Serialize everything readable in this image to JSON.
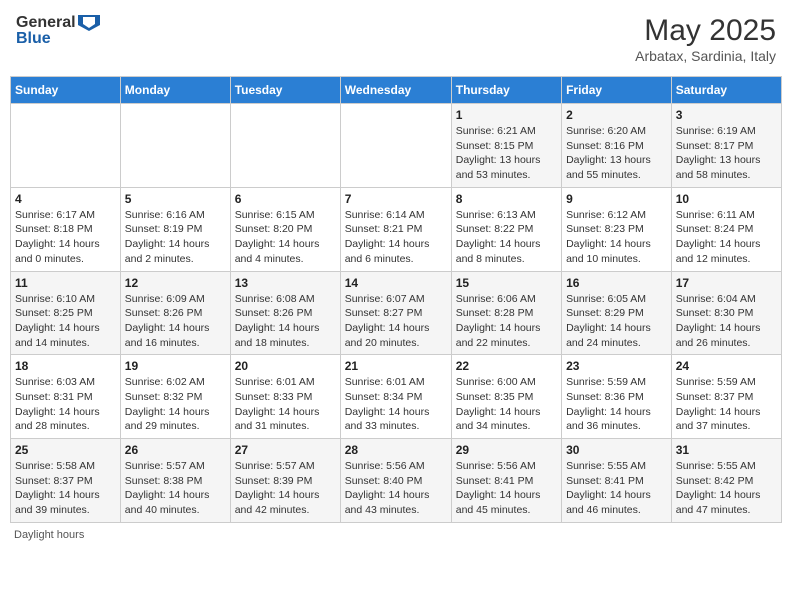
{
  "header": {
    "logo_general": "General",
    "logo_blue": "Blue",
    "title": "May 2025",
    "subtitle": "Arbatax, Sardinia, Italy"
  },
  "days_of_week": [
    "Sunday",
    "Monday",
    "Tuesday",
    "Wednesday",
    "Thursday",
    "Friday",
    "Saturday"
  ],
  "weeks": [
    [
      {
        "day": "",
        "info": ""
      },
      {
        "day": "",
        "info": ""
      },
      {
        "day": "",
        "info": ""
      },
      {
        "day": "",
        "info": ""
      },
      {
        "day": "1",
        "info": "Sunrise: 6:21 AM\nSunset: 8:15 PM\nDaylight: 13 hours and 53 minutes."
      },
      {
        "day": "2",
        "info": "Sunrise: 6:20 AM\nSunset: 8:16 PM\nDaylight: 13 hours and 55 minutes."
      },
      {
        "day": "3",
        "info": "Sunrise: 6:19 AM\nSunset: 8:17 PM\nDaylight: 13 hours and 58 minutes."
      }
    ],
    [
      {
        "day": "4",
        "info": "Sunrise: 6:17 AM\nSunset: 8:18 PM\nDaylight: 14 hours and 0 minutes."
      },
      {
        "day": "5",
        "info": "Sunrise: 6:16 AM\nSunset: 8:19 PM\nDaylight: 14 hours and 2 minutes."
      },
      {
        "day": "6",
        "info": "Sunrise: 6:15 AM\nSunset: 8:20 PM\nDaylight: 14 hours and 4 minutes."
      },
      {
        "day": "7",
        "info": "Sunrise: 6:14 AM\nSunset: 8:21 PM\nDaylight: 14 hours and 6 minutes."
      },
      {
        "day": "8",
        "info": "Sunrise: 6:13 AM\nSunset: 8:22 PM\nDaylight: 14 hours and 8 minutes."
      },
      {
        "day": "9",
        "info": "Sunrise: 6:12 AM\nSunset: 8:23 PM\nDaylight: 14 hours and 10 minutes."
      },
      {
        "day": "10",
        "info": "Sunrise: 6:11 AM\nSunset: 8:24 PM\nDaylight: 14 hours and 12 minutes."
      }
    ],
    [
      {
        "day": "11",
        "info": "Sunrise: 6:10 AM\nSunset: 8:25 PM\nDaylight: 14 hours and 14 minutes."
      },
      {
        "day": "12",
        "info": "Sunrise: 6:09 AM\nSunset: 8:26 PM\nDaylight: 14 hours and 16 minutes."
      },
      {
        "day": "13",
        "info": "Sunrise: 6:08 AM\nSunset: 8:26 PM\nDaylight: 14 hours and 18 minutes."
      },
      {
        "day": "14",
        "info": "Sunrise: 6:07 AM\nSunset: 8:27 PM\nDaylight: 14 hours and 20 minutes."
      },
      {
        "day": "15",
        "info": "Sunrise: 6:06 AM\nSunset: 8:28 PM\nDaylight: 14 hours and 22 minutes."
      },
      {
        "day": "16",
        "info": "Sunrise: 6:05 AM\nSunset: 8:29 PM\nDaylight: 14 hours and 24 minutes."
      },
      {
        "day": "17",
        "info": "Sunrise: 6:04 AM\nSunset: 8:30 PM\nDaylight: 14 hours and 26 minutes."
      }
    ],
    [
      {
        "day": "18",
        "info": "Sunrise: 6:03 AM\nSunset: 8:31 PM\nDaylight: 14 hours and 28 minutes."
      },
      {
        "day": "19",
        "info": "Sunrise: 6:02 AM\nSunset: 8:32 PM\nDaylight: 14 hours and 29 minutes."
      },
      {
        "day": "20",
        "info": "Sunrise: 6:01 AM\nSunset: 8:33 PM\nDaylight: 14 hours and 31 minutes."
      },
      {
        "day": "21",
        "info": "Sunrise: 6:01 AM\nSunset: 8:34 PM\nDaylight: 14 hours and 33 minutes."
      },
      {
        "day": "22",
        "info": "Sunrise: 6:00 AM\nSunset: 8:35 PM\nDaylight: 14 hours and 34 minutes."
      },
      {
        "day": "23",
        "info": "Sunrise: 5:59 AM\nSunset: 8:36 PM\nDaylight: 14 hours and 36 minutes."
      },
      {
        "day": "24",
        "info": "Sunrise: 5:59 AM\nSunset: 8:37 PM\nDaylight: 14 hours and 37 minutes."
      }
    ],
    [
      {
        "day": "25",
        "info": "Sunrise: 5:58 AM\nSunset: 8:37 PM\nDaylight: 14 hours and 39 minutes."
      },
      {
        "day": "26",
        "info": "Sunrise: 5:57 AM\nSunset: 8:38 PM\nDaylight: 14 hours and 40 minutes."
      },
      {
        "day": "27",
        "info": "Sunrise: 5:57 AM\nSunset: 8:39 PM\nDaylight: 14 hours and 42 minutes."
      },
      {
        "day": "28",
        "info": "Sunrise: 5:56 AM\nSunset: 8:40 PM\nDaylight: 14 hours and 43 minutes."
      },
      {
        "day": "29",
        "info": "Sunrise: 5:56 AM\nSunset: 8:41 PM\nDaylight: 14 hours and 45 minutes."
      },
      {
        "day": "30",
        "info": "Sunrise: 5:55 AM\nSunset: 8:41 PM\nDaylight: 14 hours and 46 minutes."
      },
      {
        "day": "31",
        "info": "Sunrise: 5:55 AM\nSunset: 8:42 PM\nDaylight: 14 hours and 47 minutes."
      }
    ]
  ],
  "footer": {
    "note": "Daylight hours"
  }
}
